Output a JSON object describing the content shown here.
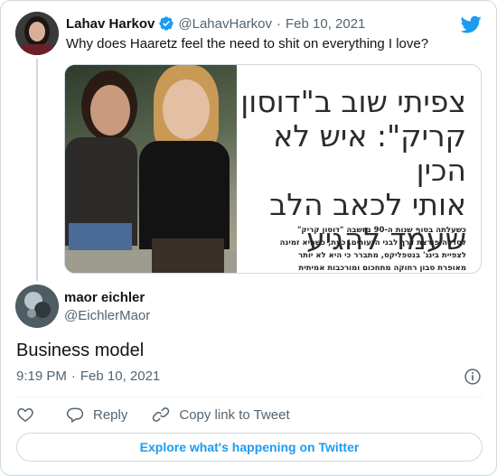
{
  "quoted_tweet": {
    "author_name": "Lahav Harkov",
    "handle": "@LahavHarkov",
    "separator": "·",
    "date": "Feb 10, 2021",
    "text": "Why does Haaretz feel the need to shit on everything I love?",
    "media": {
      "headline_lines": [
        "צפיתי שוב ב\"דוסון",
        "קריק\": איש לא הכין",
        "אותי לכאב הלב",
        "שעמד להגיע"
      ],
      "body_lines": [
        "כשעלתה בסוף שנות ה-90 נחשבה \"דוסון קריק\"",
        "לסדרה פורצת דרך לבני הנעורים. כעת, כשהיא זמינה",
        "לצפיית בינג' בנטפליקס, מתברר כי היא לא יותר",
        "מאופרת סבון רחוקה מתחכום ומורכבות אמיתית"
      ]
    }
  },
  "tweet": {
    "author_name": "maor eichler",
    "handle": "@EichlerMaor",
    "text": "Business model",
    "time": "9:19 PM",
    "separator": "·",
    "date": "Feb 10, 2021"
  },
  "actions": {
    "reply_label": "Reply",
    "copy_link_label": "Copy link to Tweet"
  },
  "explore_label": "Explore what's happening on Twitter",
  "colors": {
    "accent": "#1d9bf0",
    "secondary_text": "#536471",
    "border": "#cfd9de"
  },
  "icons": [
    "verified-badge-icon",
    "twitter-bird-icon",
    "info-icon",
    "heart-icon",
    "reply-icon",
    "link-icon"
  ]
}
